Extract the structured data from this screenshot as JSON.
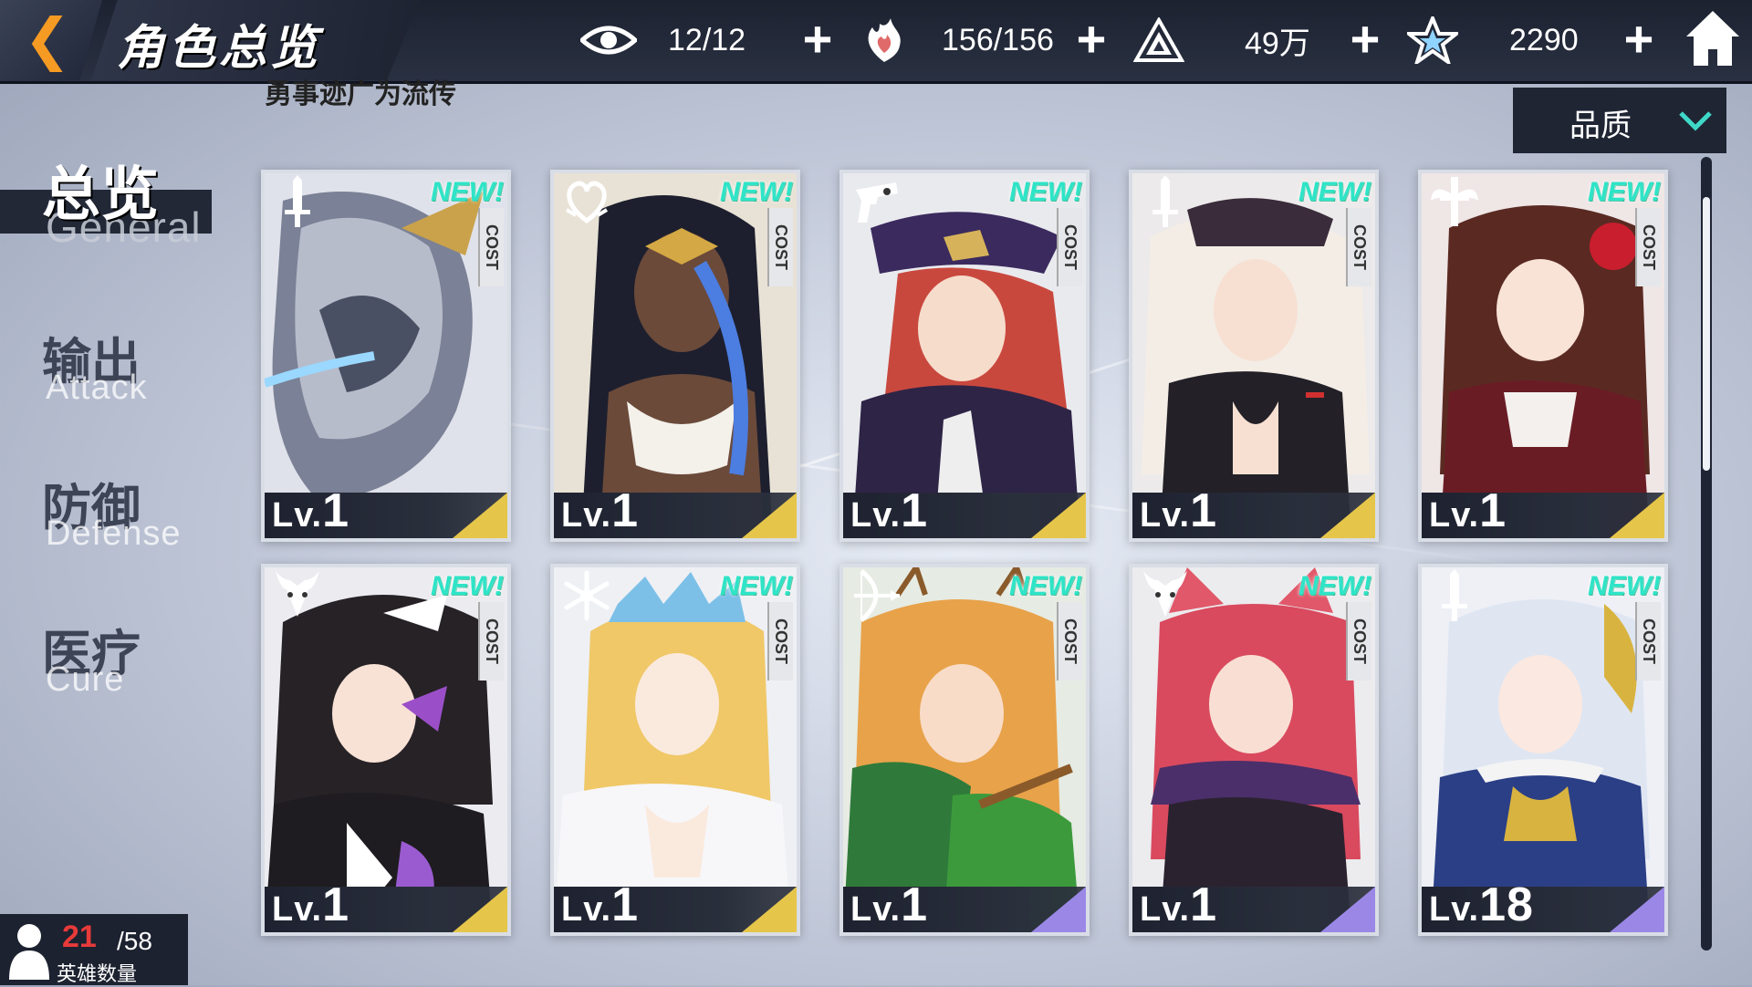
{
  "header": {
    "title": "角色总览",
    "subtitle": "勇事迹广为流传",
    "resources": [
      {
        "icon": "eye-icon",
        "value": "12/12"
      },
      {
        "icon": "heart-flame-icon",
        "value": "156/156"
      },
      {
        "icon": "triangle-emblem-icon",
        "value": "49万"
      },
      {
        "icon": "star-crystal-icon",
        "value": "2290"
      }
    ]
  },
  "sort_dropdown": {
    "label": "品质"
  },
  "tabs": [
    {
      "cn": "总览",
      "en": "General",
      "active": true
    },
    {
      "cn": "输出",
      "en": "Attack",
      "active": false
    },
    {
      "cn": "防御",
      "en": "Defense",
      "active": false
    },
    {
      "cn": "医疗",
      "en": "Cure",
      "active": false
    }
  ],
  "hero_count": {
    "current": "21",
    "max": "/58",
    "label": "英雄数量"
  },
  "card_common": {
    "cost_label": "COST",
    "new_label": "NEW!",
    "lv_prefix": "Lv."
  },
  "cards": [
    {
      "class_icon": "sword-icon",
      "level": "1",
      "is_new": true,
      "rarity_color": "#e6c64a"
    },
    {
      "class_icon": "heart-crest-icon",
      "level": "1",
      "is_new": true,
      "rarity_color": "#e6c64a"
    },
    {
      "class_icon": "pistol-icon",
      "level": "1",
      "is_new": true,
      "rarity_color": "#e6c64a"
    },
    {
      "class_icon": "sword-icon",
      "level": "1",
      "is_new": true,
      "rarity_color": "#e6c64a"
    },
    {
      "class_icon": "winged-cross-icon",
      "level": "1",
      "is_new": true,
      "rarity_color": "#e6c64a"
    },
    {
      "class_icon": "horned-mask-icon",
      "level": "1",
      "is_new": true,
      "rarity_color": "#e6c64a"
    },
    {
      "class_icon": "snowflake-icon",
      "level": "1",
      "is_new": true,
      "rarity_color": "#e6c64a"
    },
    {
      "class_icon": "bow-icon",
      "level": "1",
      "is_new": true,
      "rarity_color": "#9b88e6"
    },
    {
      "class_icon": "horned-mask-icon",
      "level": "1",
      "is_new": true,
      "rarity_color": "#9b88e6"
    },
    {
      "class_icon": "sword-icon",
      "level": "18",
      "is_new": true,
      "rarity_color": "#9b88e6"
    }
  ],
  "colors": {
    "accent_orange": "#f59a23",
    "new_teal": "#2ee4c7",
    "level_red": "#e83a3a",
    "bar_dark": "#1f2533"
  }
}
